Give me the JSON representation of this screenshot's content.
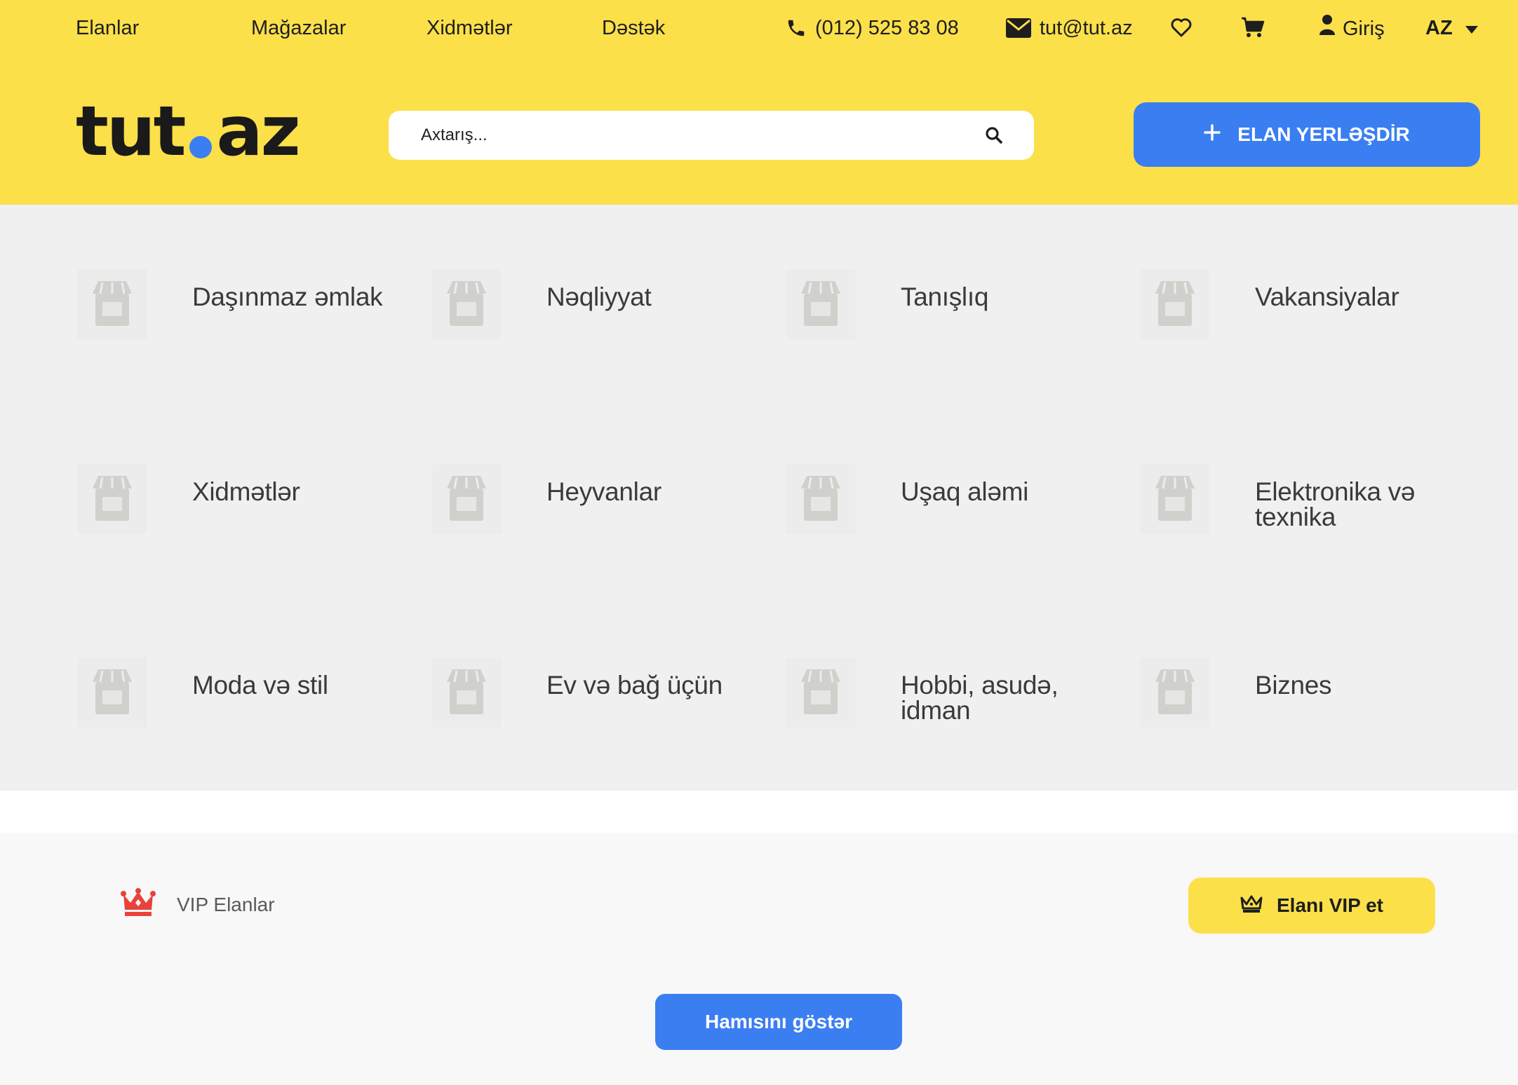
{
  "topnav": {
    "links": [
      {
        "label": "Elanlar"
      },
      {
        "label": "Mağazalar"
      },
      {
        "label": "Xidmətlər"
      },
      {
        "label": "Dəstək"
      }
    ],
    "phone": "(012) 525 83 08",
    "email": "tut@tut.az",
    "login_label": "Giriş",
    "language": "AZ"
  },
  "logo": {
    "text_left": "tut",
    "text_right": "az"
  },
  "search": {
    "placeholder": "Axtarış..."
  },
  "post_button": {
    "label": "ELAN YERLƏŞDİR"
  },
  "categories": [
    {
      "label": "Daşınmaz əmlak",
      "icon": "store-icon"
    },
    {
      "label": "Nəqliyyat",
      "icon": "store-icon"
    },
    {
      "label": "Tanışlıq",
      "icon": "store-icon"
    },
    {
      "label": "Vakansiyalar",
      "icon": "store-icon"
    },
    {
      "label": "Xidmətlər",
      "icon": "store-icon"
    },
    {
      "label": "Heyvanlar",
      "icon": "store-icon"
    },
    {
      "label": "Uşaq aləmi",
      "icon": "store-icon"
    },
    {
      "label": "Elektronika və texnika",
      "icon": "store-icon"
    },
    {
      "label": "Moda və stil",
      "icon": "store-icon"
    },
    {
      "label": "Ev və bağ üçün",
      "icon": "store-icon"
    },
    {
      "label": "Hobbi, asudə, idman",
      "icon": "store-icon"
    },
    {
      "label": "Biznes",
      "icon": "store-icon"
    }
  ],
  "vip": {
    "title": "VIP Elanlar",
    "button_label": "Elanı VIP et",
    "show_all_label": "Hamısını göstər"
  },
  "colors": {
    "brand_yellow": "#fbe04a",
    "brand_blue": "#3a7ef2",
    "crown_red": "#e8423b"
  }
}
